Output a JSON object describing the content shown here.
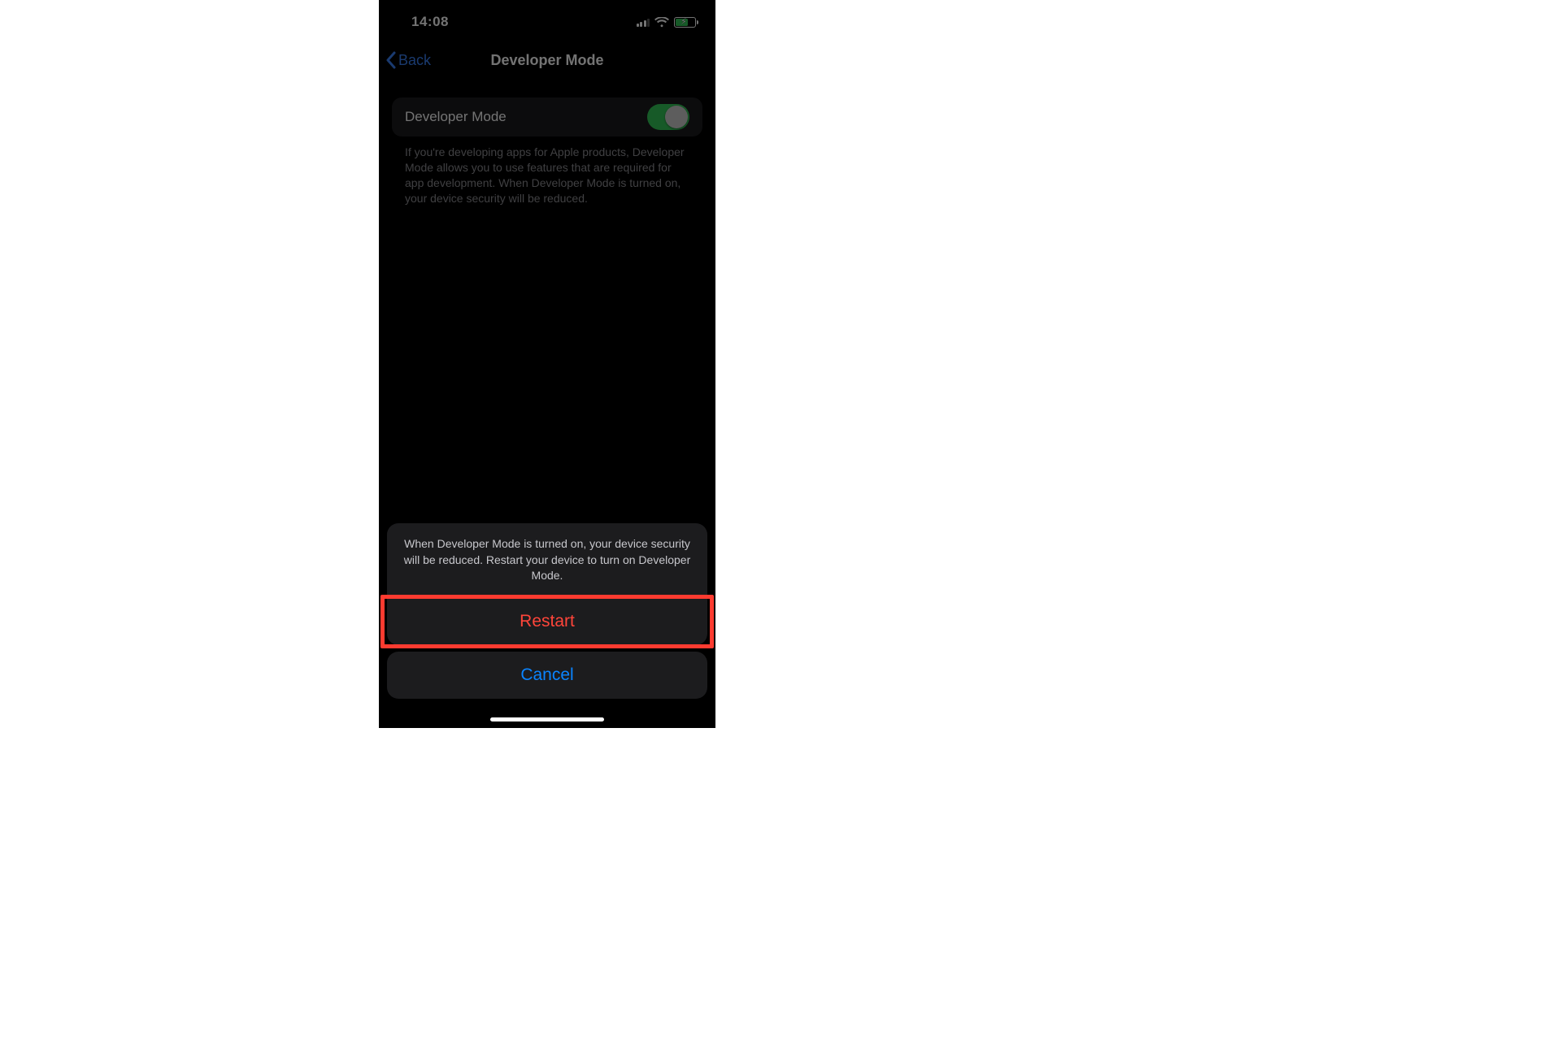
{
  "status": {
    "time": "14:08"
  },
  "nav": {
    "back_label": "Back",
    "title": "Developer Mode"
  },
  "row": {
    "label": "Developer Mode",
    "toggle_on": true,
    "description": "If you're developing apps for Apple products, Developer Mode allows you to use features that are required for app development. When Developer Mode is turned on, your device security will be reduced."
  },
  "sheet": {
    "message": "When Developer Mode is turned on, your device security will be reduced. Restart your device to turn on Developer Mode.",
    "restart_label": "Restart",
    "cancel_label": "Cancel"
  },
  "colors": {
    "toggle_on": "#34c759",
    "destructive": "#ff453a",
    "tint": "#0a84ff",
    "highlight": "#ff3b30"
  }
}
